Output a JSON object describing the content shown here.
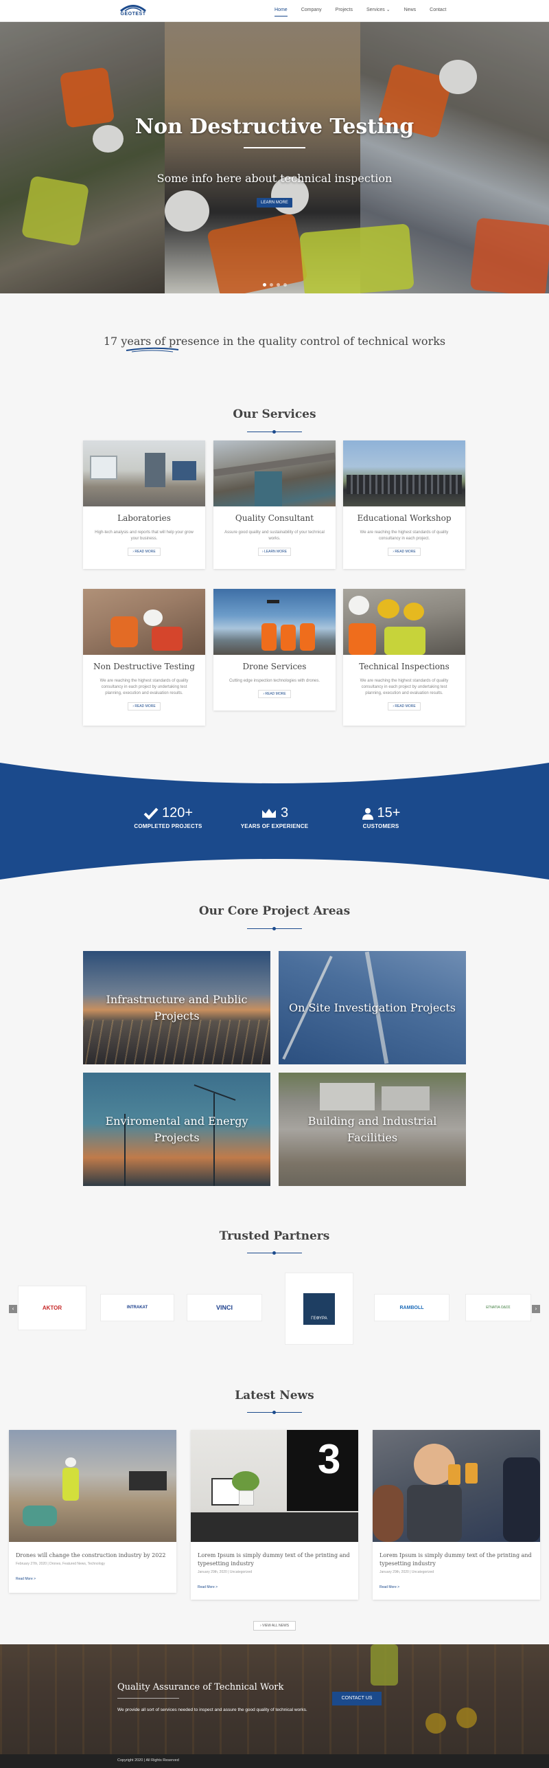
{
  "brand": {
    "name": "GEOTEST",
    "accent": "#1b4a8c"
  },
  "nav": {
    "items": [
      {
        "label": "Home",
        "active": true
      },
      {
        "label": "Company"
      },
      {
        "label": "Projects"
      },
      {
        "label": "Services"
      },
      {
        "label": "News"
      },
      {
        "label": "Contact"
      }
    ],
    "services_caret": "⌄"
  },
  "hero": {
    "title": "Non Destructive Testing",
    "subtitle": "Some info here about technical inspection",
    "button": "LEARN MORE",
    "slides": 4,
    "active_slide": 0
  },
  "presence": {
    "highlight": "17 years",
    "rest": " of presence in the quality control of technical works"
  },
  "services": {
    "title": "Our Services",
    "cards": [
      {
        "title": "Laboratories",
        "desc": "High-tech analysis and reports that will help your grow your business.",
        "button": "READ MORE"
      },
      {
        "title": "Quality Consultant",
        "desc": "Assure good quality and sustainability of your technical works.",
        "button": "LEARN MORE"
      },
      {
        "title": "Educational Workshop",
        "desc": "We are reaching the highest standards of quality consultancy in each project.",
        "button": "READ MORE"
      },
      {
        "title": "Non Destructive Testing",
        "desc": "We are reaching the highest standards of quality consultancy in each project by undertaking test planning, execution and evaluation results.",
        "button": "READ MORE"
      },
      {
        "title": "Drone Services",
        "desc": "Cutting edge inspection technologies with drones.",
        "button": "READ MORE"
      },
      {
        "title": "Technical Inspections",
        "desc": "We are reaching the highest standards of quality consultancy in each project by undertaking test planning, execution and evaluation results.",
        "button": "READ MORE"
      }
    ]
  },
  "stats": [
    {
      "icon": "check-icon",
      "value": "120+",
      "label": "COMPLETED PROJECTS"
    },
    {
      "icon": "crown-icon",
      "value": "3",
      "label": "YEARS OF EXPERIENCE"
    },
    {
      "icon": "user-icon",
      "value": "15+",
      "label": "CUSTOMERS"
    }
  ],
  "projects": {
    "title": "Our Core Project Areas",
    "tiles": [
      {
        "label": "Infrastructure and Public Projects"
      },
      {
        "label": "On Site Investigation Projects"
      },
      {
        "label": "Enviromental and Energy Projects"
      },
      {
        "label": "Building and Industrial Facilities"
      }
    ]
  },
  "partners": {
    "title": "Trusted Partners",
    "logos": [
      "AKTOR",
      "INTRAKAT",
      "VINCI",
      "ΓΕΦΥΡΑ",
      "RAMBOLL",
      "ΕΓΝΑΤΙΑ ΟΔΟΣ"
    ],
    "prev": "‹",
    "next": "›"
  },
  "news": {
    "title": "Latest News",
    "items": [
      {
        "title": "Drones will change the construction industry by 2022",
        "meta": "February 27th, 2020 | Drones, Featured News, Technology",
        "more": "Read More >"
      },
      {
        "title": "Lorem Ipsum is simply dummy text of the printing and typesetting industry",
        "meta": "January 29th, 2020 | Uncategorized",
        "more": "Read More >"
      },
      {
        "title": "Lorem Ipsum is simply dummy text of the printing and typesetting industry",
        "meta": "January 29th, 2020 | Uncategorized",
        "more": "Read More >"
      }
    ],
    "view_all": "VIEW ALL NEWS"
  },
  "cta": {
    "title": "Quality Assurance of Technical Work",
    "text": "We provide all sort of services needed to inspect and assure the good quality of technical works.",
    "button": "CONTACT US"
  },
  "footer": {
    "copyright": "Copyright 2020 | All Rights Reserved"
  }
}
